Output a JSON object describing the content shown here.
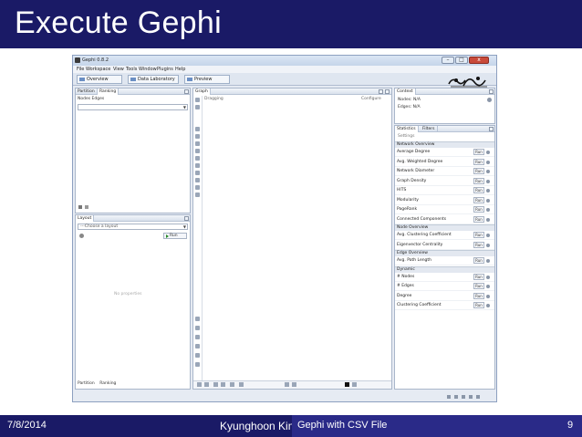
{
  "slide": {
    "title": "Execute Gephi",
    "footer_date": "7/8/2014",
    "footer_author": "Kyunghoon Kim",
    "footer_topic": "Gephi with CSV File",
    "page_number": "9"
  },
  "window": {
    "title": "Gephi 0.8.2",
    "menu": [
      "File",
      "Workspace",
      "View",
      "Tools",
      "Window",
      "Plugins",
      "Help"
    ],
    "tabs": [
      "Overview",
      "Data Laboratory",
      "Preview"
    ]
  },
  "left_top_panel": {
    "tabs": [
      "Partition",
      "Ranking"
    ],
    "subtabs": "Nodes  Edges",
    "dropdown": ""
  },
  "layout_panel": {
    "tab": "Layout",
    "dropdown": "---Choose a layout",
    "run_label": "Run",
    "empty_text": "No properties"
  },
  "left_bottom_tabs": [
    "Partition",
    "Ranking"
  ],
  "graph_panel": {
    "tab": "Graph",
    "dragging_label": "Dragging",
    "configure_label": "Configure"
  },
  "context_panel": {
    "tab": "Context",
    "nodes": "Nodes: N/A",
    "edges": "Edges: N/A"
  },
  "statistics_panel": {
    "tabs": [
      "Statistics",
      "Filters"
    ],
    "settings_label": "Settings",
    "run_label": "Run",
    "sections": [
      {
        "name": "Network Overview",
        "items": [
          "Average Degree",
          "Avg. Weighted Degree",
          "Network Diameter",
          "Graph Density",
          "HITS",
          "Modularity",
          "PageRank",
          "Connected Components"
        ]
      },
      {
        "name": "Node Overview",
        "items": [
          "Avg. Clustering Coefficient",
          "Eigenvector Centrality"
        ]
      },
      {
        "name": "Edge Overview",
        "items": [
          "Avg. Path Length"
        ]
      },
      {
        "name": "Dynamic",
        "items": [
          "# Nodes",
          "# Edges",
          "Degree",
          "Clustering Coefficient"
        ]
      }
    ]
  },
  "colors": {
    "slide_bar": "#1a1a66",
    "footer_topic": "#2a2a88",
    "window_chrome": "#e6ebf3"
  }
}
